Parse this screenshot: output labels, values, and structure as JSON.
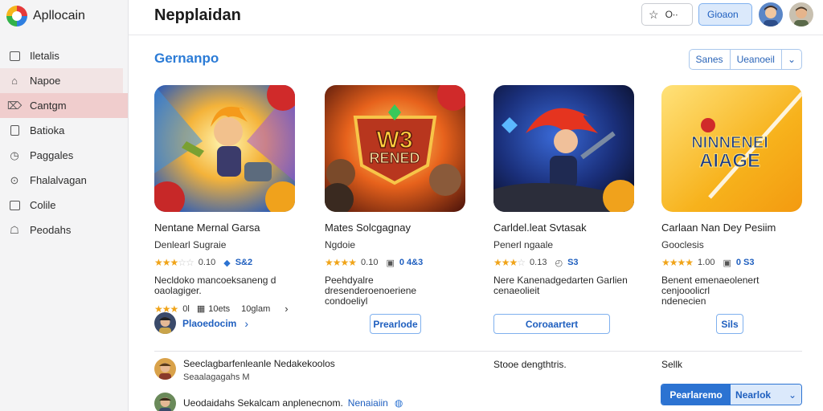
{
  "app": {
    "name": "Apllocain"
  },
  "sidebar": {
    "items": [
      {
        "label": "Iletalis",
        "icon": "box-icon"
      },
      {
        "label": "Napoe",
        "icon": "home-icon"
      },
      {
        "label": "Cantgm",
        "icon": "tag-icon"
      },
      {
        "label": "Batioka",
        "icon": "page-icon"
      },
      {
        "label": "Paggales",
        "icon": "clock-icon"
      },
      {
        "label": "Fhalalvagan",
        "icon": "circle-icon"
      },
      {
        "label": "Colile",
        "icon": "list-icon"
      },
      {
        "label": "Peodahs",
        "icon": "user-icon"
      }
    ]
  },
  "header": {
    "title": "Nepplaidan",
    "search_label": "O∙∙",
    "primary_label": "Gioaon"
  },
  "section": {
    "title": "Gernanpo",
    "seg_left": "Sanes",
    "seg_right": "Ueanoeil",
    "seg_icon": "chevron-down-icon"
  },
  "cards": [
    {
      "title": "Nentane Mernal Garsa",
      "subtitle": "Denlearl Sugraie",
      "rating": "0.10",
      "icon2": "◆",
      "count": "S&2",
      "desc": "Necldoko mancoeksaneng d\noaolagiger.",
      "extra": [
        "0l",
        "10ets",
        "10glam"
      ],
      "author_link": "Plaoedocim",
      "thumb_text": ""
    },
    {
      "title": "Mates Solcgagnay",
      "subtitle": "Ngdoie",
      "rating": "0.10",
      "icon2": "▣",
      "count": "0 4&3",
      "desc": "Peehdyalre dresenderoenoeriene\ncondoeliyl",
      "button": "Prearlode",
      "thumb_text": "W3\nRENED"
    },
    {
      "title": "Carldel.leat Svtasak",
      "subtitle": "Penerl ngaale",
      "rating": "0.13",
      "icon2": "◴",
      "count": "S3",
      "desc": "Nere Kanenadgedarten Garlien\ncenaeolieit",
      "button": "Coroaartert",
      "thumb_text": ""
    },
    {
      "title": "Carlaan Nan Dey  Pesiim",
      "subtitle": "Gooclesis",
      "rating": "1.00",
      "icon2": "▣",
      "count": "0 S3",
      "desc": "Benent emenaeolenert cenjooolicrl\nndenecien",
      "button": "Sils",
      "thumb_text": "NINNENEI\nAIAGE"
    }
  ],
  "list": [
    {
      "title": "Seeclagbarfenleanle Nedakekoolos",
      "sub": "Seaalagagahs M"
    },
    {
      "title": "Ueodaidahs Sekalcam anplenecnom.",
      "link": "Nenaiaiin"
    }
  ],
  "list_right_1": "Stooe dengthtris.",
  "list_right_2": "Sellk",
  "split_button": {
    "main": "Pearlaremo",
    "alt": "Nearlok"
  },
  "colors": {
    "accent": "#2c73d2",
    "active_nav": "#f0cdcd",
    "star": "#f0a419"
  }
}
